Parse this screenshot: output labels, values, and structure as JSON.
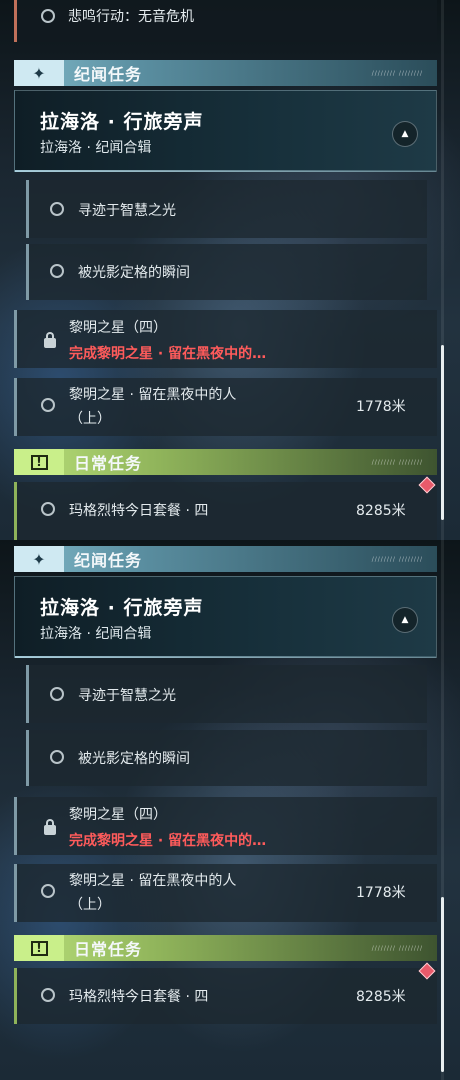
{
  "top_partial": {
    "label": "悲鸣行动：无音危机"
  },
  "story_section": {
    "title": "纪闻任务",
    "tag_icon": "sparkle-icon",
    "deco_text": "//////// ////////"
  },
  "banner": {
    "title": "拉海洛 · 行旅旁声",
    "subtitle": "拉海洛 · 纪闻合辑",
    "toggle_icon": "chevron-up-icon"
  },
  "quests": [
    {
      "label": "寻迹于智慧之光"
    },
    {
      "label": "被光影定格的瞬间"
    },
    {
      "label": "黎明之星（四）",
      "sub": "完成黎明之星 · 留在黑夜中的…",
      "icon": "lock-icon"
    },
    {
      "label": "黎明之星 · 留在黑夜中的人",
      "label2": "（上）",
      "distance": "1778米"
    }
  ],
  "daily_section": {
    "title": "日常任务",
    "tag_icon": "exclamation-flag-icon",
    "deco_text": "//////// ////////"
  },
  "daily_quests": [
    {
      "label": "玛格烈特今日套餐 · 四",
      "distance": "8285米"
    }
  ],
  "colors": {
    "story_accent": "#7fb8c8",
    "daily_accent": "#b9e07a",
    "warning_red": "#ff5b5b",
    "marker": "#e85a6a"
  }
}
